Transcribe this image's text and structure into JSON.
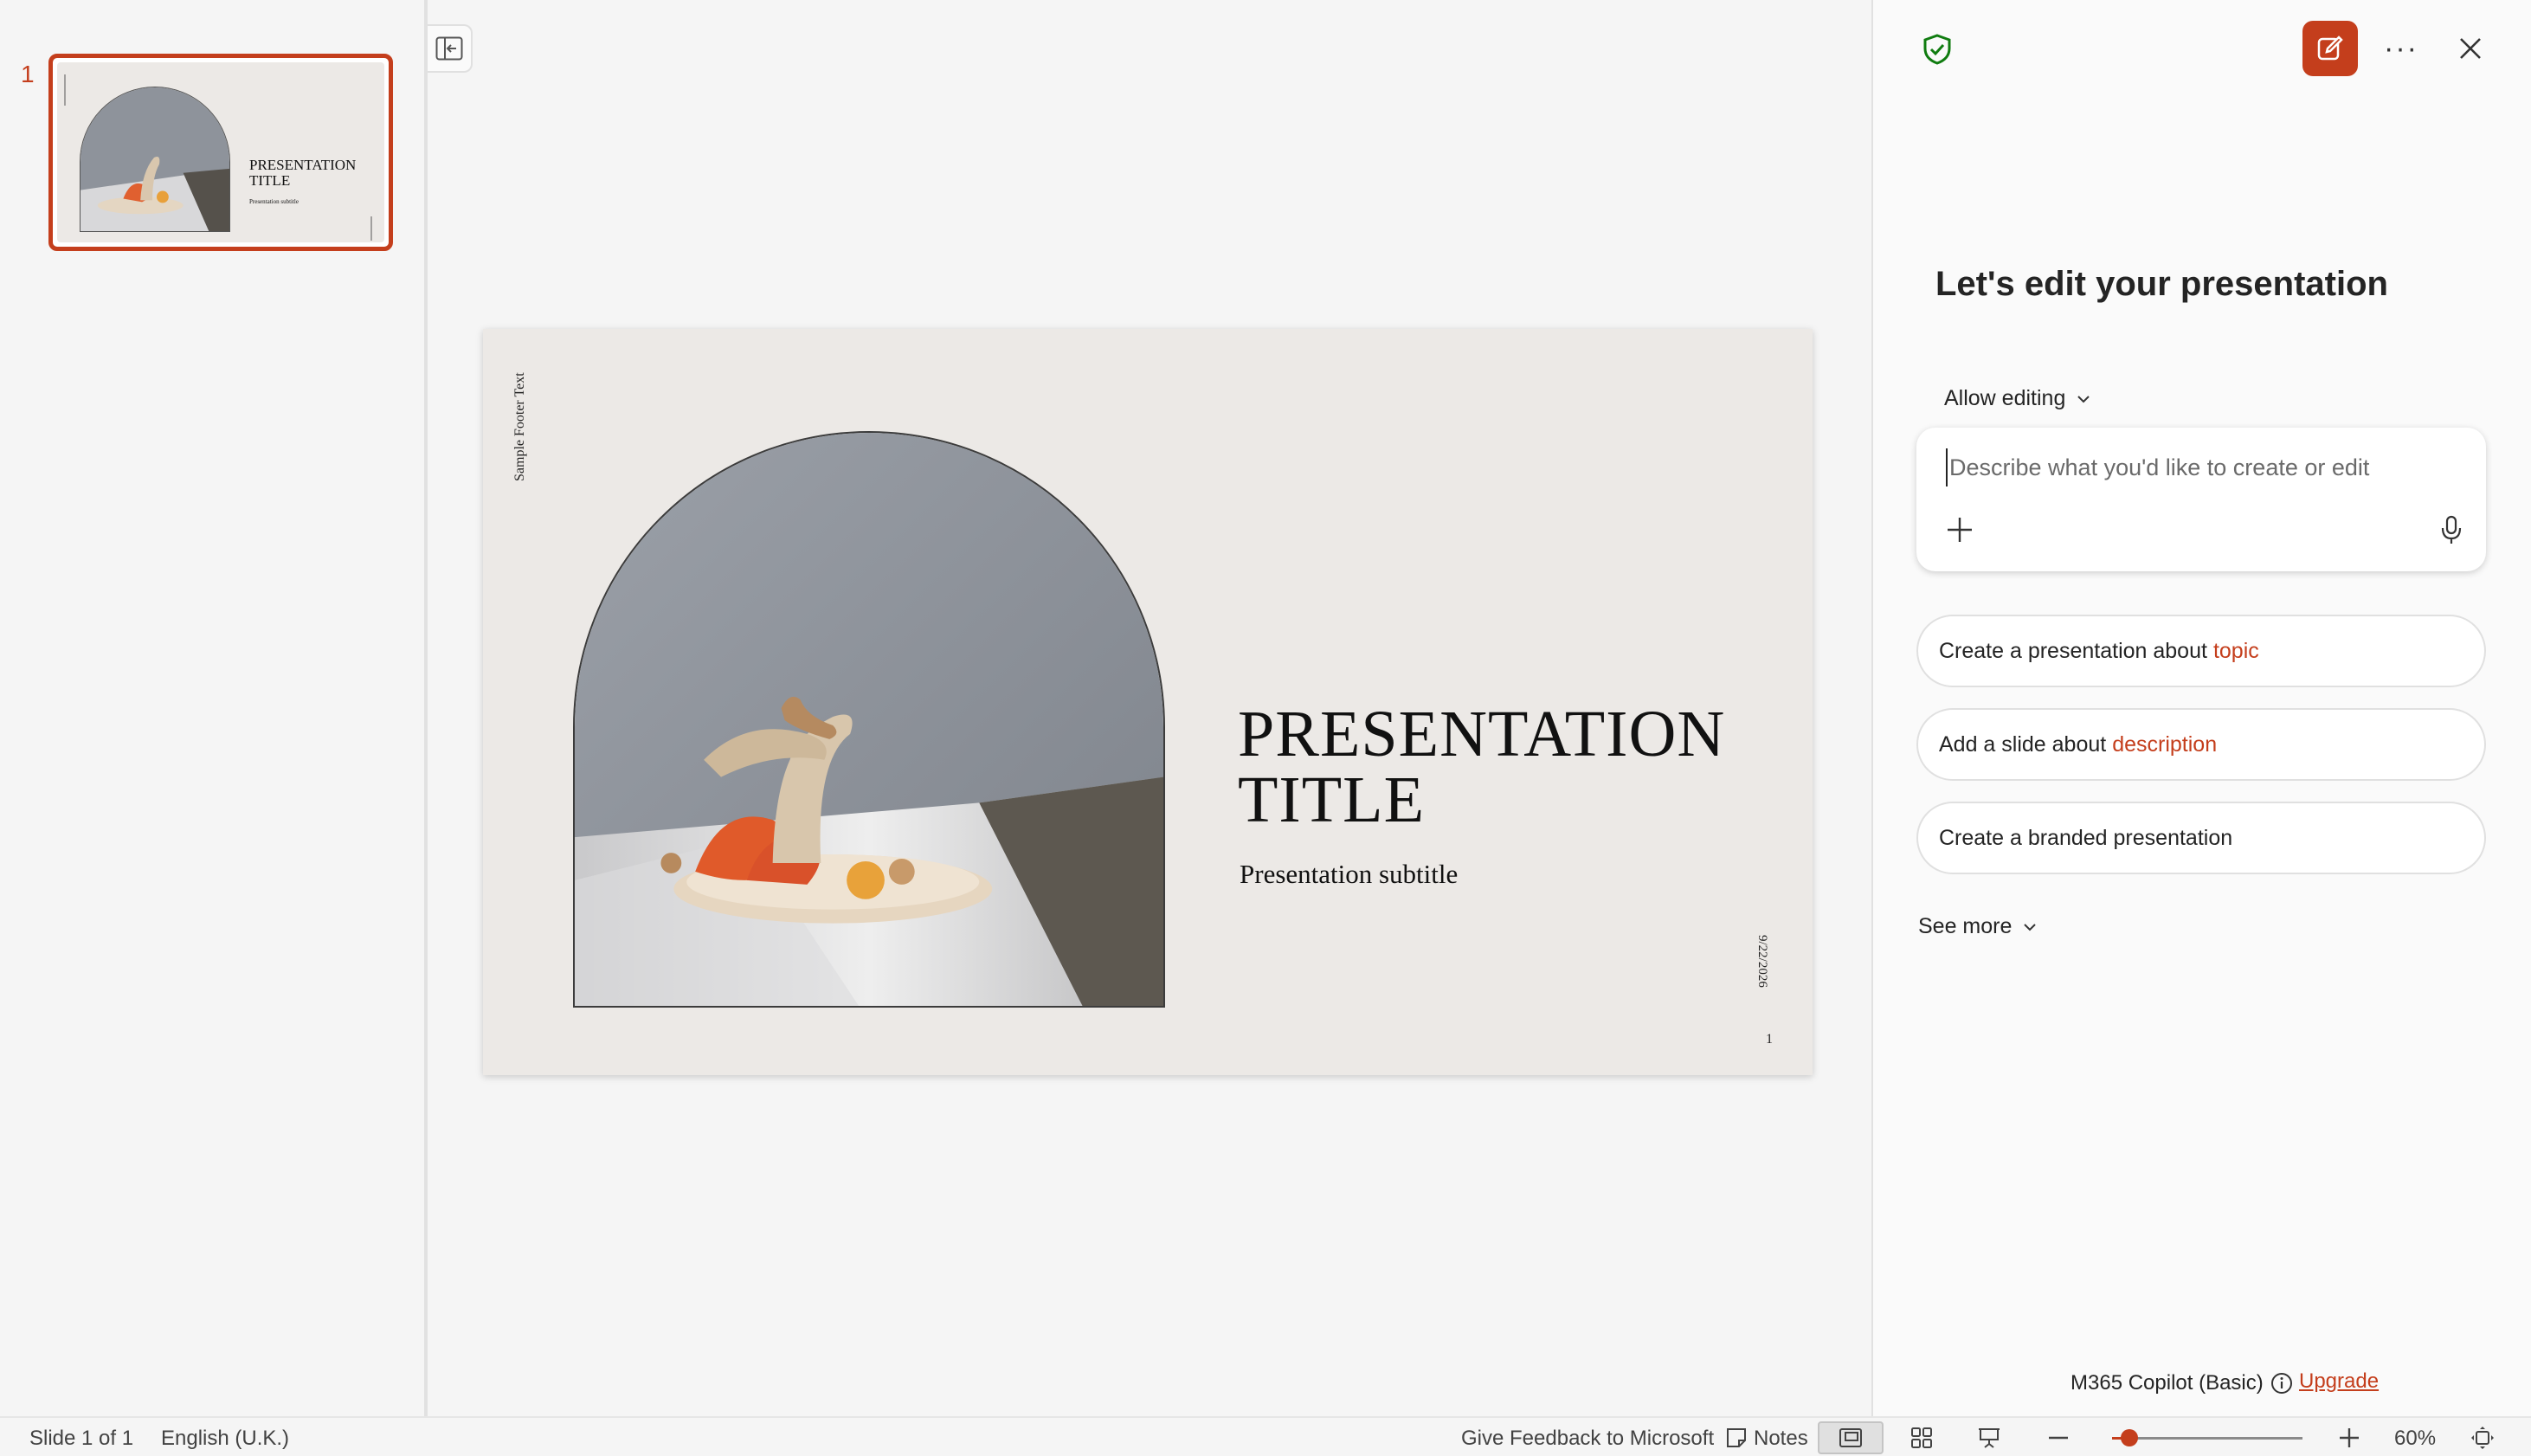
{
  "thumbnails": [
    {
      "number": "1",
      "title": "PRESENTATION TITLE",
      "subtitle": "Presentation subtitle"
    }
  ],
  "slide": {
    "footer_text": "Sample Footer Text",
    "title": "PRESENTATION TITLE",
    "subtitle": "Presentation subtitle",
    "date": "9/22/2026",
    "number": "1"
  },
  "copilot": {
    "heading": "Let's edit your presentation",
    "mode_label": "Allow editing",
    "prompt_placeholder": "Describe what you'd like to create or edit",
    "suggestions": [
      {
        "text": "Create a presentation about",
        "keyword": "topic"
      },
      {
        "text": "Add a slide about",
        "keyword": "description"
      },
      {
        "text": "Create a branded presentation",
        "keyword": ""
      }
    ],
    "see_more": "See more",
    "plan": "M365 Copilot (Basic)",
    "upgrade": "Upgrade"
  },
  "statusbar": {
    "slide_count": "Slide 1 of 1",
    "language": "English (U.K.)",
    "feedback": "Give Feedback to Microsoft",
    "notes": "Notes",
    "zoom": "60%",
    "zoom_fraction": 0.09
  },
  "colors": {
    "accent": "#c43e1c",
    "secure": "#107c10"
  },
  "icons": {
    "copilot_header": [
      "shield-check-icon",
      "new-chat-icon",
      "more-options-icon",
      "close-icon"
    ],
    "prompt": [
      "plus-icon",
      "microphone-icon"
    ],
    "statusbar": [
      "notes-icon",
      "normal-view-icon",
      "slide-sorter-icon",
      "presenter-view-icon",
      "zoom-out-icon",
      "zoom-in-icon",
      "fit-to-window-icon"
    ]
  }
}
